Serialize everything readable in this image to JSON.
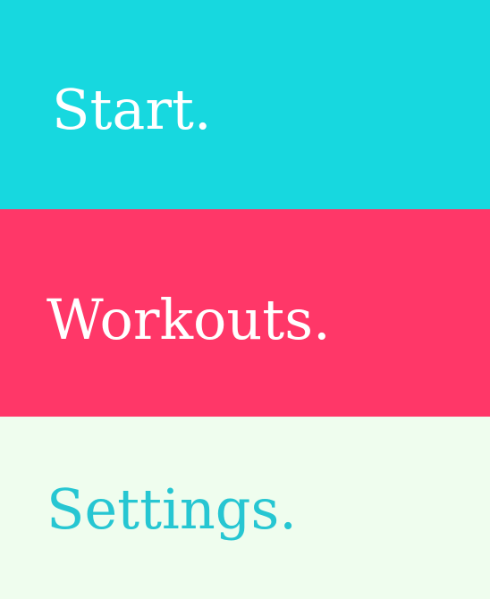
{
  "menu": {
    "items": [
      {
        "label": "Start.",
        "background_color": "#17d8df",
        "text_color": "#ffffff"
      },
      {
        "label": "Workouts.",
        "background_color": "#ff3768",
        "text_color": "#ffffff"
      },
      {
        "label": "Settings.",
        "background_color": "#effdee",
        "text_color": "#26c6d2"
      }
    ]
  }
}
